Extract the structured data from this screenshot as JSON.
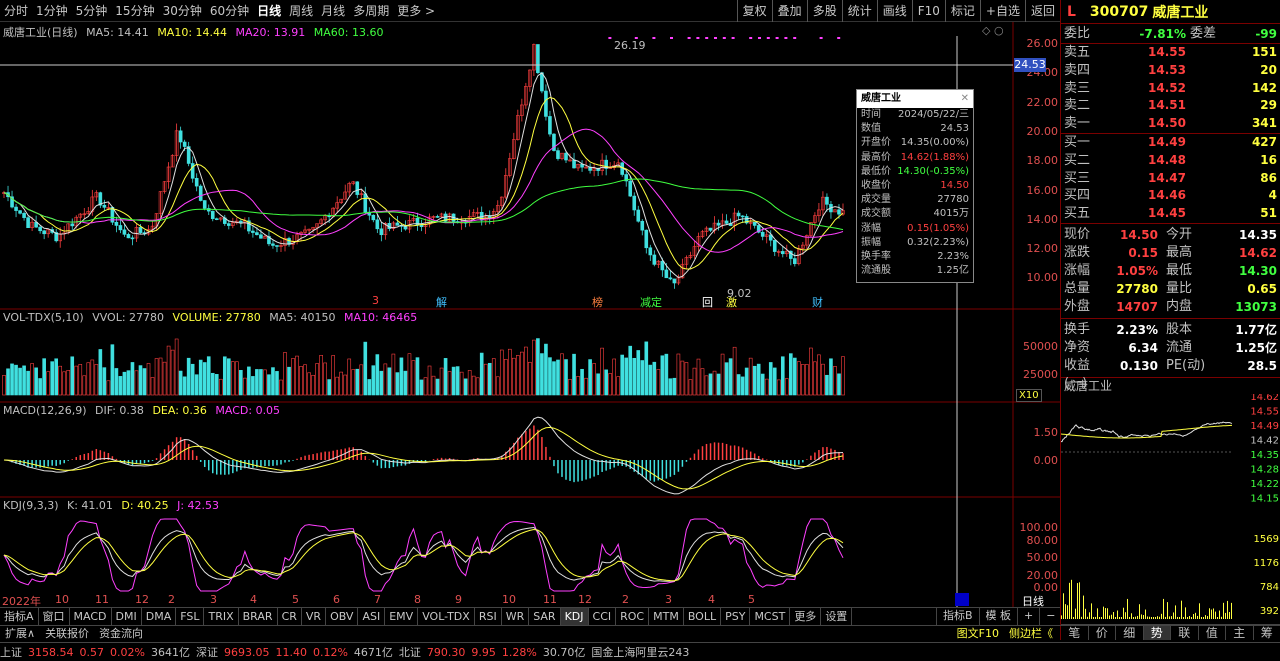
{
  "toolbar": {
    "periods": [
      "分时",
      "1分钟",
      "5分钟",
      "15分钟",
      "30分钟",
      "60分钟",
      "日线",
      "周线",
      "月线",
      "多周期",
      "更多 >"
    ],
    "active": "日线",
    "right": [
      "复权",
      "叠加",
      "多股",
      "统计",
      "画线",
      "F10",
      "标记",
      "+自选",
      "返回"
    ]
  },
  "main": {
    "title": "威唐工业(日线)",
    "ma5": "MA5: 14.41",
    "ma10": "MA10: 14.44",
    "ma20": "MA20: 13.91",
    "ma60": "MA60: 13.60",
    "yticks": [
      "26.00",
      "24.00",
      "22.00",
      "20.00",
      "18.00",
      "16.00",
      "14.00",
      "12.00",
      "10.00"
    ],
    "cursor_price": "24.53",
    "high_label": "26.19",
    "low_label": "9.02",
    "markers": [
      "3",
      "解",
      "榜",
      "减",
      "定",
      "回",
      "激",
      "财"
    ]
  },
  "tooltip": {
    "title": "威唐工业",
    "rows": [
      {
        "k": "时间",
        "v": "2024/05/22/三",
        "c": "#c0c0c0"
      },
      {
        "k": "数值",
        "v": "24.53",
        "c": "#c0c0c0"
      },
      {
        "k": "开盘价",
        "v": "14.35(0.00%)",
        "c": "#c0c0c0"
      },
      {
        "k": "最高价",
        "v": "14.62(1.88%)",
        "c": "#ff4040"
      },
      {
        "k": "最低价",
        "v": "14.30(-0.35%)",
        "c": "#40ff40"
      },
      {
        "k": "收盘价",
        "v": "14.50",
        "c": "#ff4040"
      },
      {
        "k": "成交量",
        "v": "27780",
        "c": "#c0c0c0"
      },
      {
        "k": "成交额",
        "v": "4015万",
        "c": "#c0c0c0"
      },
      {
        "k": "涨幅",
        "v": "0.15(1.05%)",
        "c": "#ff4040"
      },
      {
        "k": "振幅",
        "v": "0.32(2.23%)",
        "c": "#c0c0c0"
      },
      {
        "k": "换手率",
        "v": "2.23%",
        "c": "#c0c0c0"
      },
      {
        "k": "流通股",
        "v": "1.25亿",
        "c": "#c0c0c0"
      }
    ]
  },
  "vol": {
    "name": "VOL-TDX(5,10)",
    "vvol": "VVOL: 27780",
    "volume": "VOLUME: 27780",
    "ma5": "MA5: 40150",
    "ma10": "MA10: 46465",
    "yticks": [
      "50000",
      "25000"
    ],
    "unit": "X10"
  },
  "macd": {
    "name": "MACD(12,26,9)",
    "dif": "DIF: 0.38",
    "dea": "DEA: 0.36",
    "macd": "MACD: 0.05",
    "yticks": [
      "1.50",
      "0.00"
    ]
  },
  "kdj": {
    "name": "KDJ(9,3,3)",
    "k": "K: 41.01",
    "d": "D: 40.25",
    "j": "J: 42.53",
    "yticks": [
      "100.00",
      "80.00",
      "50.00",
      "20.00",
      "0.00"
    ]
  },
  "xaxis": [
    "2022年",
    "10",
    "11",
    "12",
    "2",
    "3",
    "4",
    "5",
    "6",
    "7",
    "8",
    "9",
    "10",
    "11",
    "12",
    "2",
    "3",
    "4",
    "5"
  ],
  "period_label": "日线",
  "bottom_tabs": [
    "指标A",
    "窗口",
    "MACD",
    "DMI",
    "DMA",
    "FSL",
    "TRIX",
    "BRAR",
    "CR",
    "VR",
    "OBV",
    "ASI",
    "EMV",
    "VOL-TDX",
    "RSI",
    "WR",
    "SAR",
    "KDJ",
    "CCI",
    "ROC",
    "MTM",
    "BOLL",
    "PSY",
    "MCST",
    "更多",
    "设置"
  ],
  "bottom_active": "KDJ",
  "bottom_right": [
    "指标B",
    "模 板",
    "+",
    "−"
  ],
  "bot2_left": [
    "扩展∧",
    "关联报价",
    "资金流向"
  ],
  "bot2_right": [
    "图文F10",
    "侧边栏《"
  ],
  "right_tabs": [
    "笔",
    "价",
    "细",
    "势",
    "联",
    "值",
    "主",
    "筹"
  ],
  "right_tab_active": "势",
  "stock": {
    "flag": "L",
    "code": "300707",
    "name": "威唐工业"
  },
  "weibi": {
    "label": "委比",
    "value": "-7.81%",
    "label2": "委差",
    "value2": "-99"
  },
  "asks": [
    {
      "label": "卖五",
      "price": "14.55",
      "vol": "151"
    },
    {
      "label": "卖四",
      "price": "14.53",
      "vol": "20"
    },
    {
      "label": "卖三",
      "price": "14.52",
      "vol": "142"
    },
    {
      "label": "卖二",
      "price": "14.51",
      "vol": "29"
    },
    {
      "label": "卖一",
      "price": "14.50",
      "vol": "341"
    }
  ],
  "bids": [
    {
      "label": "买一",
      "price": "14.49",
      "vol": "427"
    },
    {
      "label": "买二",
      "price": "14.48",
      "vol": "16"
    },
    {
      "label": "买三",
      "price": "14.47",
      "vol": "86"
    },
    {
      "label": "买四",
      "price": "14.46",
      "vol": "4"
    },
    {
      "label": "买五",
      "price": "14.45",
      "vol": "51"
    }
  ],
  "quote": [
    {
      "a": "现价",
      "b": "14.50",
      "bc": "red",
      "c": "今开",
      "d": "14.35",
      "dc": "wht"
    },
    {
      "a": "涨跌",
      "b": "0.15",
      "bc": "red",
      "c": "最高",
      "d": "14.62",
      "dc": "red"
    },
    {
      "a": "涨幅",
      "b": "1.05%",
      "bc": "red",
      "c": "最低",
      "d": "14.30",
      "dc": "green"
    },
    {
      "a": "总量",
      "b": "27780",
      "bc": "yel",
      "c": "量比",
      "d": "0.65",
      "dc": "yel"
    },
    {
      "a": "外盘",
      "b": "14707",
      "bc": "red",
      "c": "内盘",
      "d": "13073",
      "dc": "green"
    }
  ],
  "quote2": [
    {
      "a": "换手",
      "b": "2.23%",
      "bc": "wht",
      "c": "股本",
      "d": "1.77亿",
      "dc": "wht"
    },
    {
      "a": "净资",
      "b": "6.34",
      "bc": "wht",
      "c": "流通",
      "d": "1.25亿",
      "dc": "wht"
    },
    {
      "a": "收益(一)",
      "b": "0.130",
      "bc": "wht",
      "c": "PE(动)",
      "d": "28.5",
      "dc": "wht"
    }
  ],
  "mini": {
    "title": "威唐工业",
    "yticks": [
      "14.62",
      "14.55",
      "14.49",
      "14.42",
      "14.35",
      "14.28",
      "14.22",
      "14.15"
    ],
    "vticks": [
      "1569",
      "1176",
      "784",
      "392"
    ]
  },
  "status": [
    {
      "t": "上证",
      "c": "#c0c0c0"
    },
    {
      "t": "3158.54",
      "c": "#ff4040"
    },
    {
      "t": "0.57",
      "c": "#ff4040"
    },
    {
      "t": "0.02%",
      "c": "#ff4040"
    },
    {
      "t": "3641亿",
      "c": "#c0c0c0"
    },
    {
      "t": "深证",
      "c": "#c0c0c0"
    },
    {
      "t": "9693.05",
      "c": "#ff4040"
    },
    {
      "t": "11.40",
      "c": "#ff4040"
    },
    {
      "t": "0.12%",
      "c": "#ff4040"
    },
    {
      "t": "4671亿",
      "c": "#c0c0c0"
    },
    {
      "t": "北证",
      "c": "#c0c0c0"
    },
    {
      "t": "790.30",
      "c": "#ff4040"
    },
    {
      "t": "9.95",
      "c": "#ff4040"
    },
    {
      "t": "1.28%",
      "c": "#ff4040"
    },
    {
      "t": "30.70亿",
      "c": "#c0c0c0"
    },
    {
      "t": "国金上海阿里云243",
      "c": "#c0c0c0"
    }
  ]
}
